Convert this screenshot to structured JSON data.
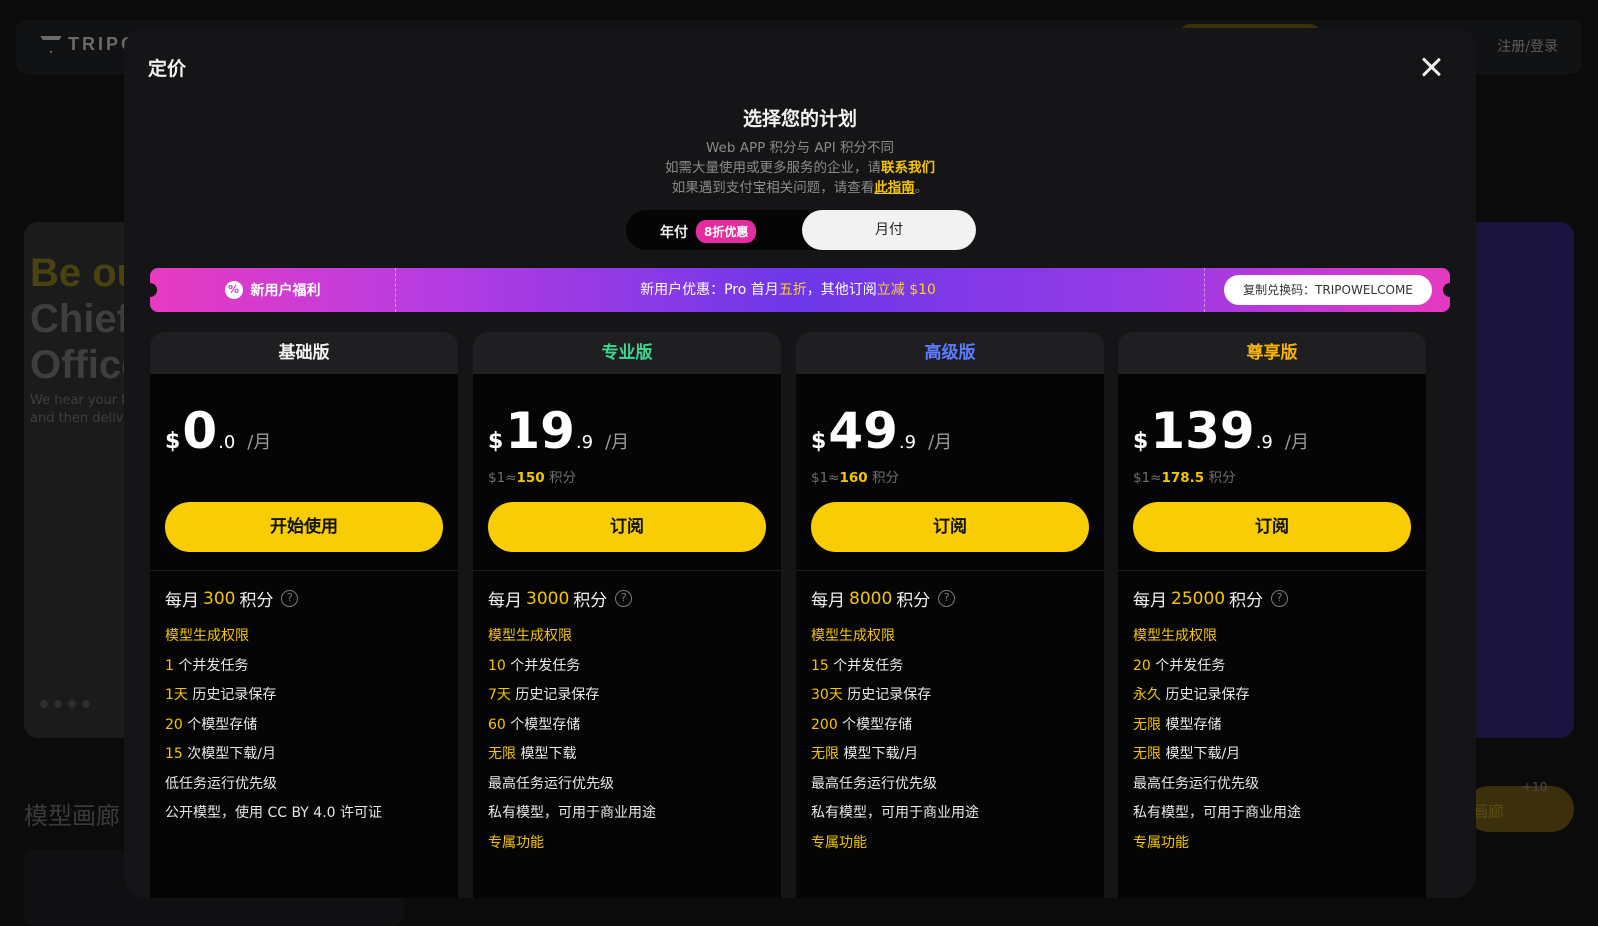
{
  "background": {
    "logo": "TRIPO",
    "login": "注册/登录",
    "hero_lines": [
      "Be ou",
      "Chief",
      "Office"
    ],
    "hero_sub": [
      "We hear your fe",
      "and then delive"
    ],
    "gallery_title": "模型画廊",
    "gallery_button": "画廊",
    "gallery_plus": "+10"
  },
  "modal": {
    "title": "定价",
    "heading": "选择您的计划",
    "sub1": "Web APP 积分与 API 积分不同",
    "sub2_prefix": "如需大量使用或更多服务的企业，请",
    "sub2_link": "联系我们",
    "sub3_prefix": "如果遇到支付宝相关问题，请查看",
    "sub3_link": "此指南",
    "sub3_suffix": "。"
  },
  "billing": {
    "yearly": "年付",
    "yearly_badge": "8折优惠",
    "monthly": "月付",
    "selected": "monthly"
  },
  "promo": {
    "left_icon": "%",
    "left_label": "新用户福利",
    "text_a": "新用户优惠：Pro 首月",
    "text_b": "五折",
    "text_c": "，其他订阅",
    "text_d": "立减 $10",
    "copy_label": "复制兑换码：TRIPOWELCOME"
  },
  "plans": [
    {
      "name": "基础版",
      "name_color": "#f2f2f2",
      "currency": "$",
      "price_int": "0",
      "price_dec": ".0",
      "period": "/月",
      "rate_prefix": "",
      "rate_value": "",
      "rate_suffix": "",
      "cta": "开始使用",
      "credits_prefix": "每月",
      "credits_value": "300",
      "credits_suffix": "积分",
      "features": [
        {
          "hl": "模型生成权限",
          "text": ""
        },
        {
          "hl": "1",
          "text": " 个并发任务"
        },
        {
          "hl": "1天",
          "text": " 历史记录保存"
        },
        {
          "hl": "20",
          "text": " 个模型存储"
        },
        {
          "hl": "15",
          "text": " 次模型下载/月"
        },
        {
          "hl": "",
          "text": "低任务运行优先级"
        },
        {
          "hl": "",
          "text": "公开模型，使用 CC BY 4.0 许可证"
        }
      ],
      "exclusive": ""
    },
    {
      "name": "专业版",
      "name_color": "#3dd68c",
      "currency": "$",
      "price_int": "19",
      "price_dec": ".9",
      "period": "/月",
      "rate_prefix": "$1≈",
      "rate_value": "150",
      "rate_suffix": " 积分",
      "cta": "订阅",
      "credits_prefix": "每月",
      "credits_value": "3000",
      "credits_suffix": "积分",
      "features": [
        {
          "hl": "模型生成权限",
          "text": ""
        },
        {
          "hl": "10",
          "text": " 个并发任务"
        },
        {
          "hl": "7天",
          "text": " 历史记录保存"
        },
        {
          "hl": "60",
          "text": " 个模型存储"
        },
        {
          "hl": "无限",
          "text": " 模型下载"
        },
        {
          "hl": "",
          "text": "最高任务运行优先级"
        },
        {
          "hl": "",
          "text": "私有模型，可用于商业用途"
        }
      ],
      "exclusive": "专属功能"
    },
    {
      "name": "高级版",
      "name_color": "#5c7cff",
      "currency": "$",
      "price_int": "49",
      "price_dec": ".9",
      "period": "/月",
      "rate_prefix": "$1≈",
      "rate_value": "160",
      "rate_suffix": " 积分",
      "cta": "订阅",
      "credits_prefix": "每月",
      "credits_value": "8000",
      "credits_suffix": "积分",
      "features": [
        {
          "hl": "模型生成权限",
          "text": ""
        },
        {
          "hl": "15",
          "text": " 个并发任务"
        },
        {
          "hl": "30天",
          "text": " 历史记录保存"
        },
        {
          "hl": "200",
          "text": " 个模型存储"
        },
        {
          "hl": "无限",
          "text": " 模型下载/月"
        },
        {
          "hl": "",
          "text": "最高任务运行优先级"
        },
        {
          "hl": "",
          "text": "私有模型，可用于商业用途"
        }
      ],
      "exclusive": "专属功能"
    },
    {
      "name": "尊享版",
      "name_color": "#f5b400",
      "currency": "$",
      "price_int": "139",
      "price_dec": ".9",
      "period": "/月",
      "rate_prefix": "$1≈",
      "rate_value": "178.5",
      "rate_suffix": " 积分",
      "cta": "订阅",
      "credits_prefix": "每月",
      "credits_value": "25000",
      "credits_suffix": "积分",
      "features": [
        {
          "hl": "模型生成权限",
          "text": ""
        },
        {
          "hl": "20",
          "text": " 个并发任务"
        },
        {
          "hl": "永久",
          "text": " 历史记录保存"
        },
        {
          "hl": "无限",
          "text": " 模型存储"
        },
        {
          "hl": "无限",
          "text": " 模型下载/月"
        },
        {
          "hl": "",
          "text": "最高任务运行优先级"
        },
        {
          "hl": "",
          "text": "私有模型，可用于商业用途"
        }
      ],
      "exclusive": "专属功能"
    }
  ]
}
